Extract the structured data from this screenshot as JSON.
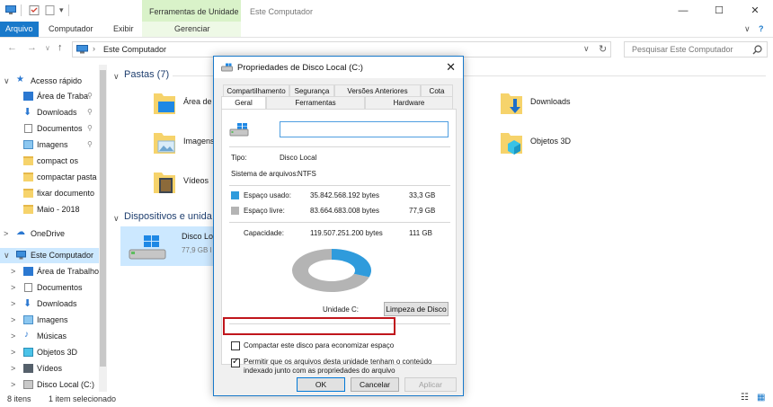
{
  "titlebar": {
    "context_tab_header": "Ferramentas de Unidade",
    "window_title": "Este Computador",
    "minimize": "—",
    "maximize": "☐",
    "close": "✕"
  },
  "ribbon": {
    "tabs": [
      {
        "label": "Arquivo"
      },
      {
        "label": "Computador"
      },
      {
        "label": "Exibir"
      },
      {
        "label": "Gerenciar"
      }
    ],
    "help": "?"
  },
  "addressbar": {
    "back": "←",
    "forward": "→",
    "recent": "∨",
    "up": "↑",
    "crumb": "Este Computador",
    "dropdown": "∨",
    "refresh": "↻",
    "search_placeholder": "Pesquisar Este Computador"
  },
  "navpane": {
    "items": [
      {
        "label": "Acesso rápido",
        "icon": "star-icon",
        "expander": "∨"
      },
      {
        "label": "Área de Traba",
        "icon": "desktop-icon",
        "pin": "📌"
      },
      {
        "label": "Downloads",
        "icon": "download-icon",
        "pin": "📌"
      },
      {
        "label": "Documentos",
        "icon": "documents-icon",
        "pin": "📌"
      },
      {
        "label": "Imagens",
        "icon": "pictures-icon",
        "pin": "📌"
      },
      {
        "label": "compact os",
        "icon": "folder-icon"
      },
      {
        "label": "compactar pasta",
        "icon": "folder-icon"
      },
      {
        "label": "fixar documento",
        "icon": "folder-icon"
      },
      {
        "label": "Maio - 2018",
        "icon": "folder-icon"
      },
      {
        "label": "OneDrive",
        "icon": "cloud-icon",
        "expander": ">"
      },
      {
        "label": "Este Computador",
        "icon": "computer-icon",
        "expander": "∨"
      },
      {
        "label": "Área de Trabalho",
        "icon": "desktop-icon",
        "expander": ">"
      },
      {
        "label": "Documentos",
        "icon": "documents-icon",
        "expander": ">"
      },
      {
        "label": "Downloads",
        "icon": "download-icon",
        "expander": ">"
      },
      {
        "label": "Imagens",
        "icon": "pictures-icon",
        "expander": ">"
      },
      {
        "label": "Músicas",
        "icon": "music-icon",
        "expander": ">"
      },
      {
        "label": "Objetos 3D",
        "icon": "cube-icon",
        "expander": ">"
      },
      {
        "label": "Vídeos",
        "icon": "video-icon",
        "expander": ">"
      },
      {
        "label": "Disco Local (C:)",
        "icon": "drive-icon",
        "expander": ">"
      }
    ]
  },
  "content": {
    "folders_group": "Pastas (7)",
    "folders": [
      {
        "label": "Área de T",
        "icon": "desktop-folder-icon"
      },
      {
        "label": "Imagens",
        "icon": "pictures-folder-icon"
      },
      {
        "label": "Vídeos",
        "icon": "video-folder-icon"
      },
      {
        "label": "Downloads",
        "icon": "download-folder-icon"
      },
      {
        "label": "Objetos 3D",
        "icon": "cube-folder-icon"
      }
    ],
    "devices_group": "Dispositivos e unida",
    "drive": {
      "label": "Disco Lo",
      "sub": "77,9 GB l",
      "icon": "windows-drive-icon"
    }
  },
  "statusbar": {
    "items": "8 itens",
    "selected": "1 item selecionado"
  },
  "dialog": {
    "title": "Propriedades de Disco Local (C:)",
    "close": "✕",
    "tabs_row1": [
      "Compartilhamento",
      "Segurança",
      "Versões Anteriores",
      "Cota"
    ],
    "tabs_row2": [
      "Geral",
      "Ferramentas",
      "Hardware"
    ],
    "active_tab": "Geral",
    "name_value": "",
    "type_label": "Tipo:",
    "type_value": "Disco Local",
    "fs_label": "Sistema de arquivos:",
    "fs_value": "NTFS",
    "used_label": "Espaço usado:",
    "used_bytes": "35.842.568.192 bytes",
    "used_gb": "33,3 GB",
    "free_label": "Espaço livre:",
    "free_bytes": "83.664.683.008 bytes",
    "free_gb": "77,9 GB",
    "cap_label": "Capacidade:",
    "cap_bytes": "119.507.251.200 bytes",
    "cap_gb": "111 GB",
    "drive_label": "Unidade C:",
    "cleanup_button": "Limpeza de Disco",
    "compress_label": "Compactar este disco para economizar espaço",
    "compress_checked": false,
    "index_label_1": "Permitir que os arquivos desta unidade tenham o conteúdo",
    "index_label_2": "indexado junto com as propriedades do arquivo",
    "index_checked": true,
    "ok": "OK",
    "cancel": "Cancelar",
    "apply": "Aplicar",
    "used_fraction": 0.3,
    "colors": {
      "used": "#2f9bdc",
      "free": "#b4b4b4",
      "accent": "#1979ca",
      "highlight": "#c0161c"
    }
  }
}
